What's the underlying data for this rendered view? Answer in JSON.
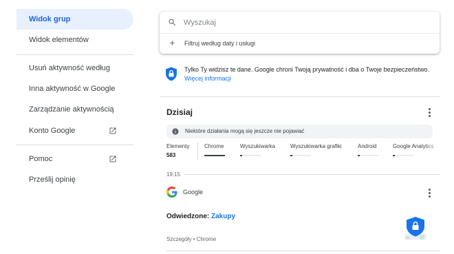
{
  "sidebar": {
    "items": [
      {
        "label": "Widok grup"
      },
      {
        "label": "Widok elementów"
      },
      {
        "label": "Usuń aktywność według"
      },
      {
        "label": "Inna aktywność w Google"
      },
      {
        "label": "Zarządzanie aktywnością"
      },
      {
        "label": "Konto Google"
      },
      {
        "label": "Pomoc"
      },
      {
        "label": "Prześlij opinię"
      }
    ]
  },
  "search": {
    "placeholder": "Wyszukaj",
    "filter_label": "Filtruj według daty i usługi"
  },
  "privacy": {
    "text": "Tylko Ty widzisz te dane. Google chroni Twoją prywatność i dba o Twoje bezpieczeństwo.",
    "link": "Więcej informacji"
  },
  "today": {
    "title": "Dzisiaj",
    "notice": "Niektóre działania mogą się jeszcze nie pojawiać",
    "count_label": "Elementy",
    "count_value": "583",
    "stats": [
      {
        "label": "Chrome",
        "fill": 1.0
      },
      {
        "label": "Wyszukiwarka",
        "fill": 0.1
      },
      {
        "label": "Wyszukiwarka grafiki",
        "fill": 0.1
      },
      {
        "label": "Android",
        "fill": 0.1
      },
      {
        "label": "Google Analytics",
        "fill": 0.1
      }
    ]
  },
  "entry": {
    "time": "19:15",
    "product": "Google",
    "visited_prefix": "Odwiedzone: ",
    "visited_link": "Zakupy",
    "details": "Szczegóły • Chrome"
  },
  "colors": {
    "accent": "#1a73e8",
    "active_bg": "#e8f0fe",
    "shield": "#1a73e8"
  },
  "icons": {
    "search": "search-icon",
    "add": "plus-icon",
    "privacy": "shield-lock-icon",
    "info": "info-icon",
    "more": "more-vert-icon",
    "external": "open-in-new-icon"
  }
}
